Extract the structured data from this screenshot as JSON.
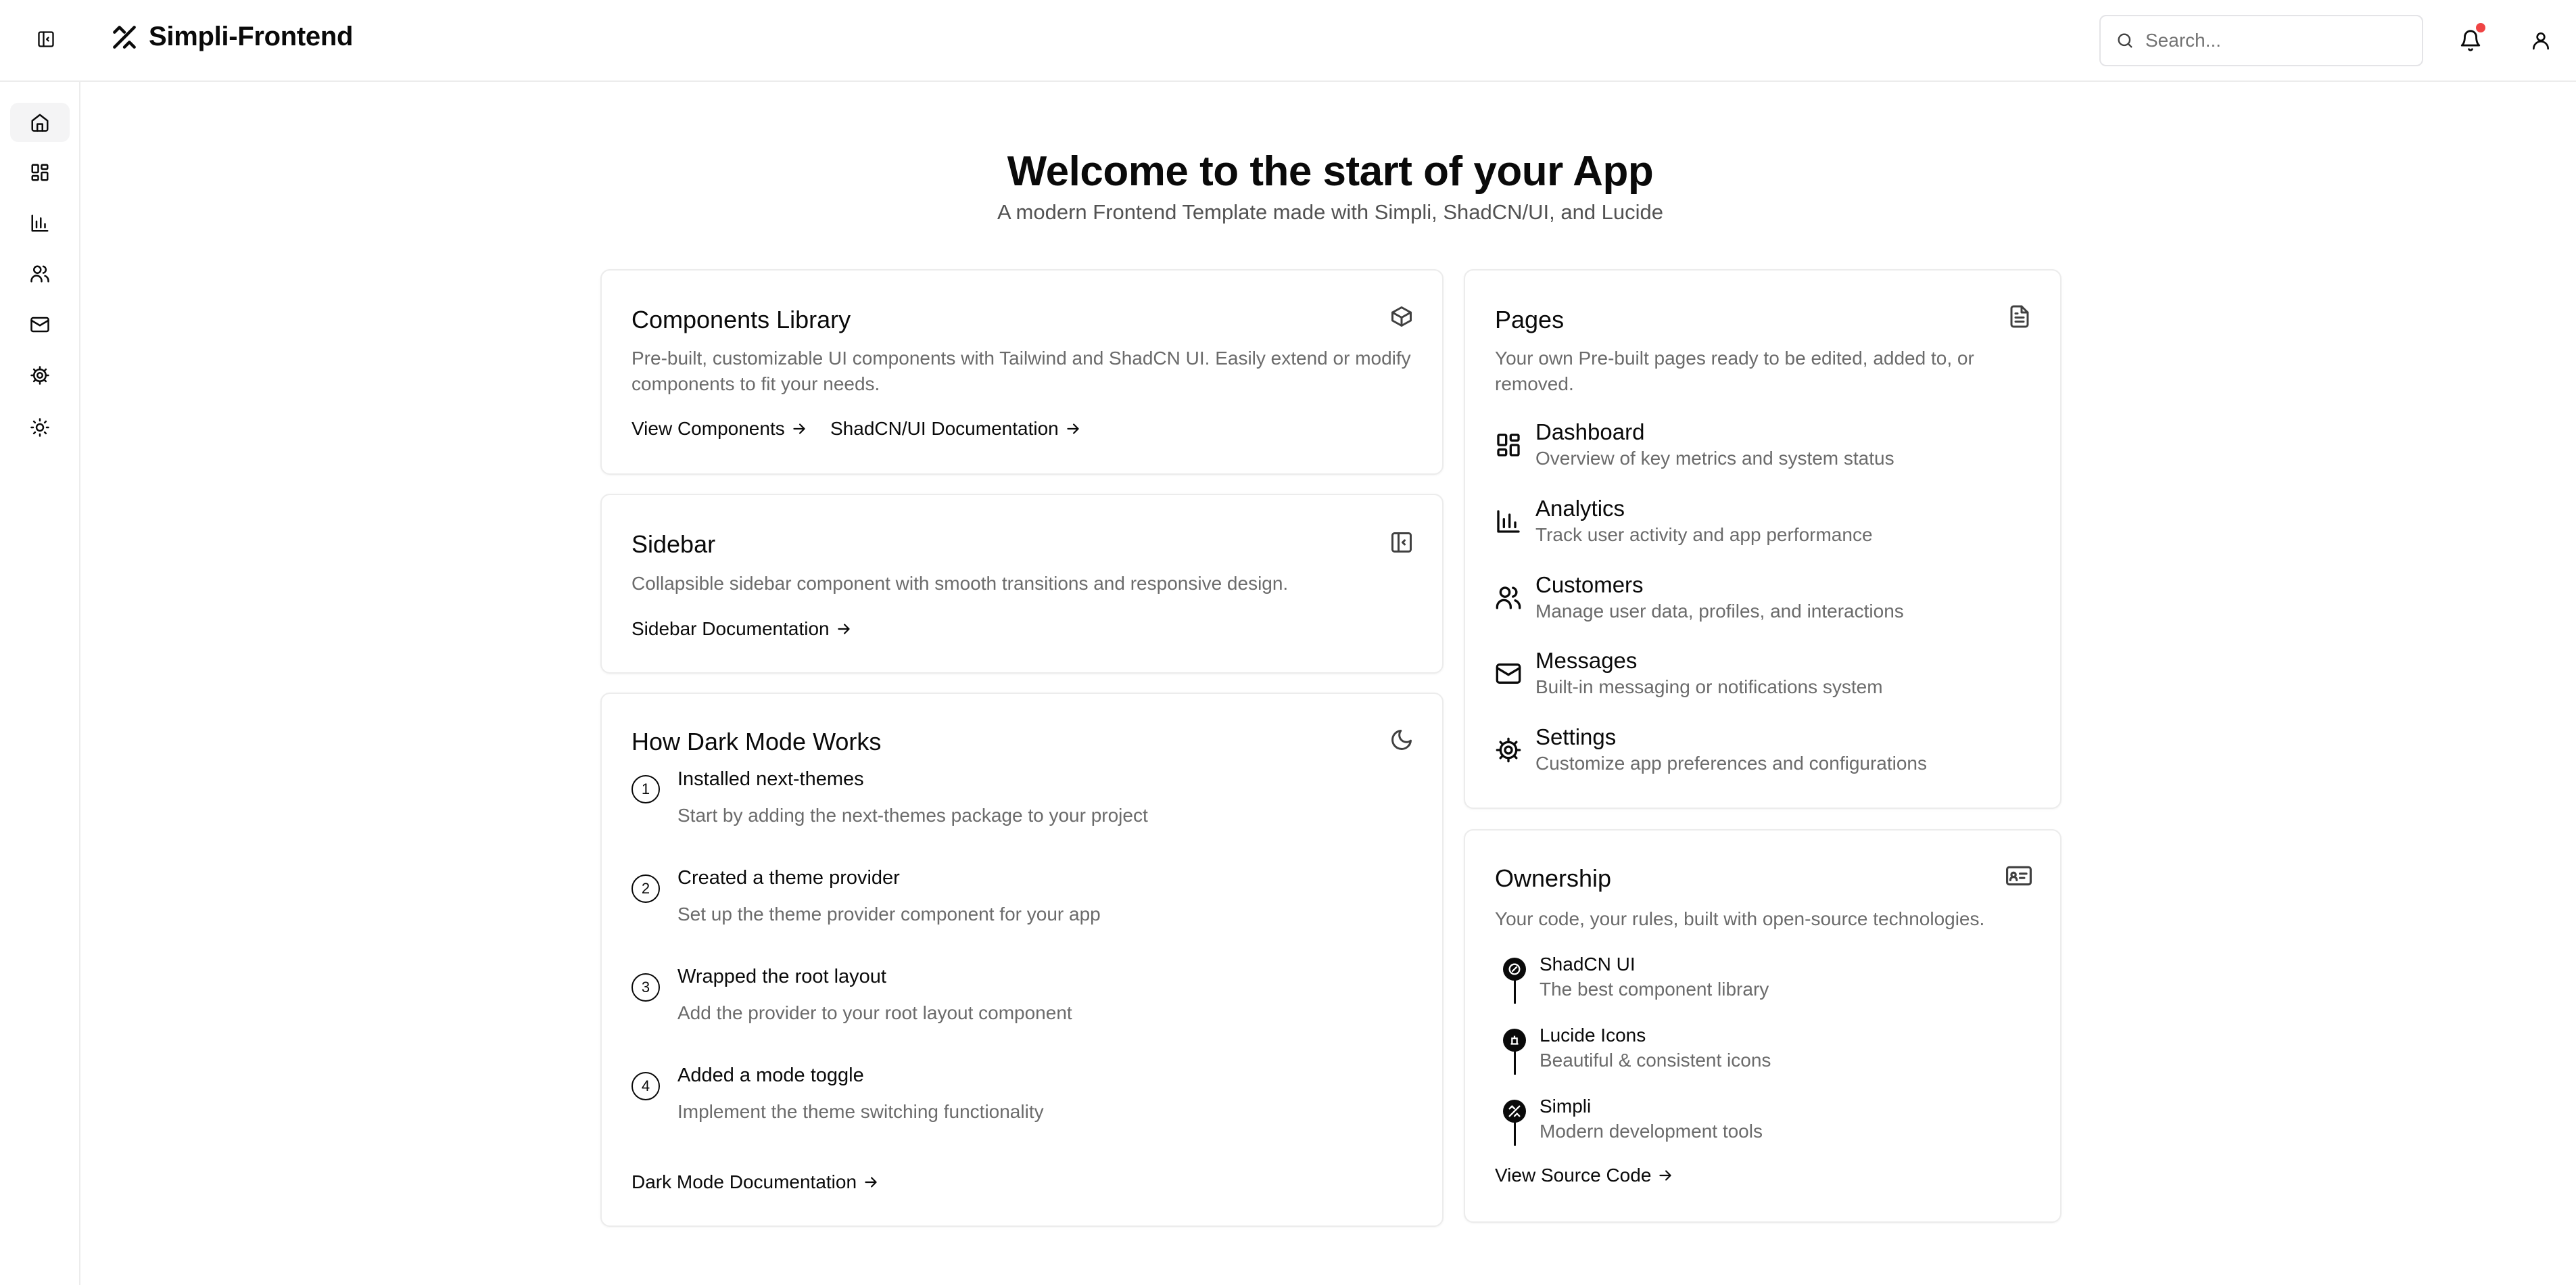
{
  "header": {
    "brand": "Simpli-Frontend",
    "search_placeholder": "Search...",
    "notification_color": "#ef4444"
  },
  "sidebar": {
    "items": [
      {
        "icon": "home-icon",
        "active": true
      },
      {
        "icon": "dashboard-icon"
      },
      {
        "icon": "chart-icon"
      },
      {
        "icon": "users-icon"
      },
      {
        "icon": "mail-icon"
      },
      {
        "icon": "gear-icon"
      },
      {
        "icon": "sun-icon"
      }
    ]
  },
  "hero": {
    "title": "Welcome to the start of your App",
    "subtitle": "A modern Frontend Template made with Simpli, ShadCN/UI, and Lucide"
  },
  "components_card": {
    "title": "Components Library",
    "description": "Pre-built, customizable UI components with Tailwind and ShadCN UI. Easily extend or modify components to fit your needs.",
    "links": [
      "View Components",
      "ShadCN/UI Documentation"
    ]
  },
  "sidebar_card": {
    "title": "Sidebar",
    "description": "Collapsible sidebar component with smooth transitions and responsive design.",
    "link": "Sidebar Documentation"
  },
  "darkmode_card": {
    "title": "How Dark Mode Works",
    "steps": [
      {
        "num": "1",
        "title": "Installed next-themes",
        "desc": "Start by adding the next-themes package to your project"
      },
      {
        "num": "2",
        "title": "Created a theme provider",
        "desc": "Set up the theme provider component for your app"
      },
      {
        "num": "3",
        "title": "Wrapped the root layout",
        "desc": "Add the provider to your root layout component"
      },
      {
        "num": "4",
        "title": "Added a mode toggle",
        "desc": "Implement the theme switching functionality"
      }
    ],
    "link": "Dark Mode Documentation"
  },
  "pages_card": {
    "title": "Pages",
    "description": "Your own Pre-built pages ready to be edited, added to, or removed.",
    "items": [
      {
        "title": "Dashboard",
        "desc": "Overview of key metrics and system status",
        "icon": "dashboard-icon"
      },
      {
        "title": "Analytics",
        "desc": "Track user activity and app performance",
        "icon": "chart-icon"
      },
      {
        "title": "Customers",
        "desc": "Manage user data, profiles, and interactions",
        "icon": "users-icon"
      },
      {
        "title": "Messages",
        "desc": "Built-in messaging or notifications system",
        "icon": "mail-icon"
      },
      {
        "title": "Settings",
        "desc": "Customize app preferences and configurations",
        "icon": "gear-icon"
      }
    ]
  },
  "ownership_card": {
    "title": "Ownership",
    "description": "Your code, your rules, built with open-source technologies.",
    "items": [
      {
        "title": "ShadCN UI",
        "desc": "The best component library"
      },
      {
        "title": "Lucide Icons",
        "desc": "Beautiful & consistent icons"
      },
      {
        "title": "Simpli",
        "desc": "Modern development tools"
      }
    ],
    "link": "View Source Code"
  }
}
